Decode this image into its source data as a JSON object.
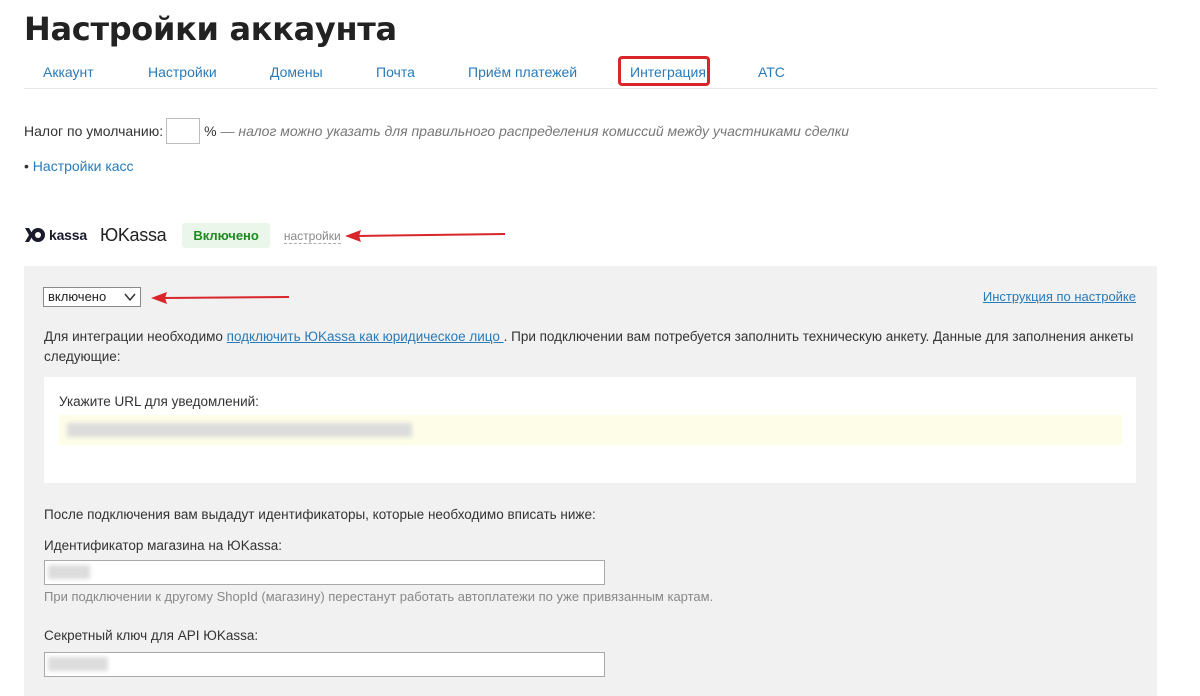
{
  "page": {
    "title": "Настройки аккаунта"
  },
  "tabs": [
    {
      "label": "Аккаунт"
    },
    {
      "label": "Настройки"
    },
    {
      "label": "Домены"
    },
    {
      "label": "Почта"
    },
    {
      "label": "Приём платежей"
    },
    {
      "label": "Интеграция",
      "highlighted": true
    },
    {
      "label": "АТС"
    }
  ],
  "tax": {
    "label": "Налог по умолчанию:",
    "value": "",
    "unit": "%",
    "hint": "— налог можно указать для правильного распределения комиссий между участниками сделки"
  },
  "cash_settings": {
    "bullet": "•",
    "link": "Настройки касс"
  },
  "provider": {
    "logo_text": "kassa",
    "name": "ЮKassa",
    "status": "Включено",
    "settings_link": "настройки",
    "status_color": "#1f8a1f"
  },
  "panel": {
    "select_value": "включено",
    "instruction_link": "Инструкция по настройке",
    "intro_before": "Для интеграции необходимо ",
    "intro_link": "подключить ЮKassa как юридическое лицо ",
    "intro_after": ". При подключении вам потребуется заполнить техническую анкету. Данные для заполнения анкеты следующие:",
    "url_label": "Укажите URL для уведомлений:",
    "after_connect": "После подключения вам выдадут идентификаторы, которые необходимо вписать ниже:",
    "shop_id_label": "Идентификатор магазина на ЮKassa:",
    "shop_id_hint": "При подключении к другому ShopId (магазину) перестанут работать автоплатежи по уже привязанным картам.",
    "secret_label": "Секретный ключ для API ЮKassa:"
  },
  "colors": {
    "accent": "#2a7ab8",
    "annotation": "#d9262b",
    "panel_bg": "#f1f1f1"
  }
}
